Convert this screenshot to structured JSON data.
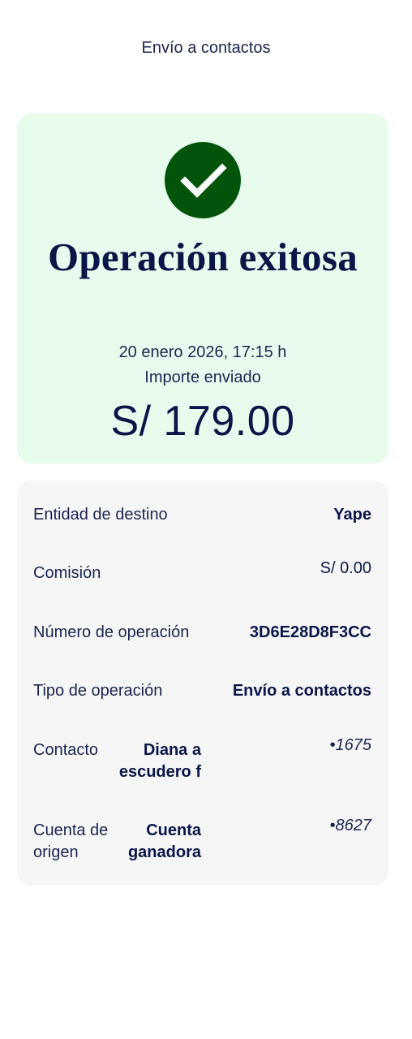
{
  "header": {
    "title": "Envío a contactos"
  },
  "success": {
    "title": "Operación exitosa",
    "date": "20 enero 2026, 17:15 h",
    "amount_label": "Importe enviado",
    "amount": "S/ 179.00",
    "check_color": "#03540b",
    "card_color": "#e8fcee"
  },
  "details": {
    "destination_label": "Entidad de destino",
    "destination_value": "Yape",
    "commission_label": "Comisión",
    "commission_value": "S/ 0.00",
    "operation_number_label": "Número de operación",
    "operation_number_value": "3D6E28D8F3CC",
    "operation_type_label": "Tipo de operación",
    "operation_type_value": "Envío a contactos",
    "contact_label": "Contacto",
    "contact_name_line1": "Diana a",
    "contact_name_line2": "escudero f",
    "contact_number": "•1675",
    "origin_label_line1": "Cuenta de",
    "origin_label_line2": "origen",
    "origin_name_line1": "Cuenta",
    "origin_name_line2": "ganadora",
    "origin_number": "•8627"
  }
}
